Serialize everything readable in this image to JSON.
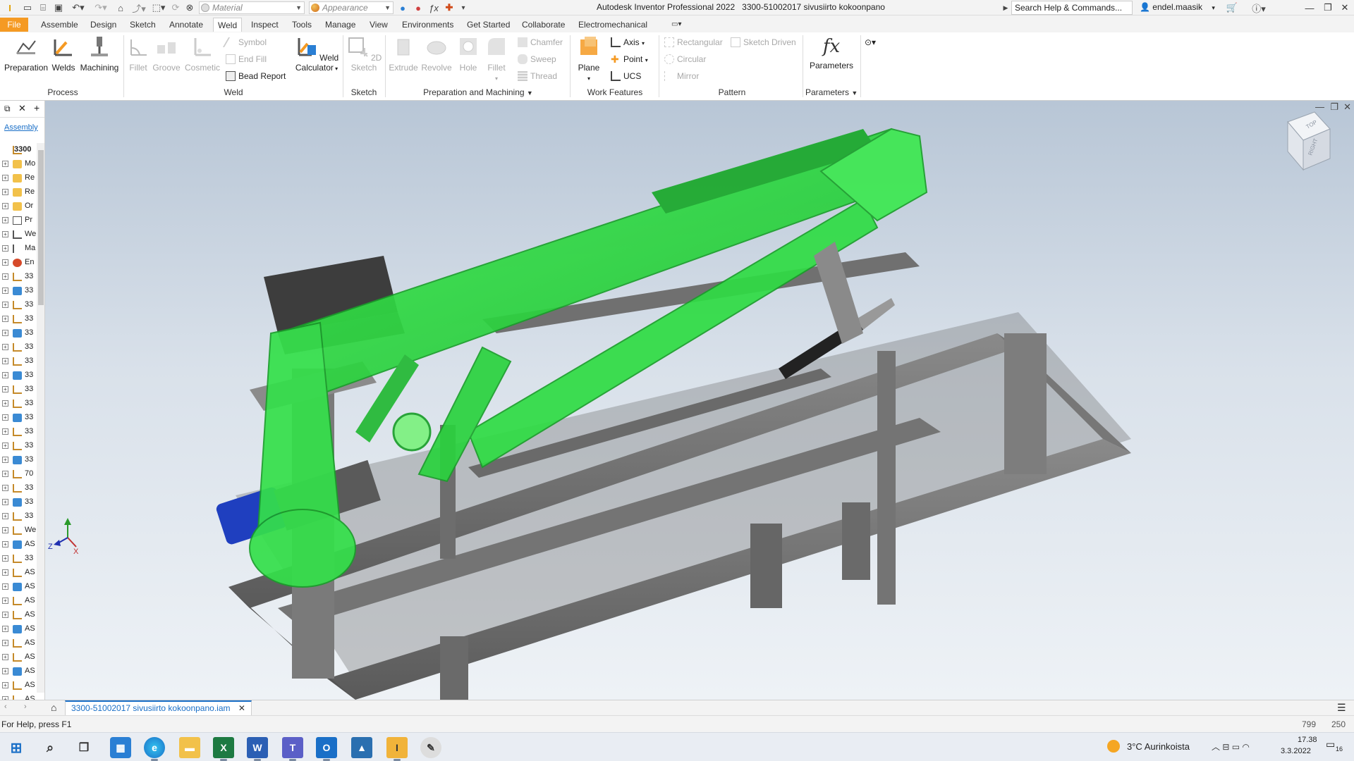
{
  "window": {
    "title": "Autodesk Inventor Professional 2022",
    "document_title": "3300-51002017 sivusiirto kokoonpano"
  },
  "quick_access": {
    "material_combo": "Material",
    "appearance_combo": "Appearance",
    "search_placeholder": "Search Help & Commands...",
    "user": "endel.maasik"
  },
  "tabs": [
    {
      "label": "File"
    },
    {
      "label": "Assemble"
    },
    {
      "label": "Design"
    },
    {
      "label": "Sketch"
    },
    {
      "label": "Annotate"
    },
    {
      "label": "Weld"
    },
    {
      "label": "Inspect"
    },
    {
      "label": "Tools"
    },
    {
      "label": "Manage"
    },
    {
      "label": "View"
    },
    {
      "label": "Environments"
    },
    {
      "label": "Get Started"
    },
    {
      "label": "Collaborate"
    },
    {
      "label": "Electromechanical"
    }
  ],
  "active_tab": "Weld",
  "ribbon": {
    "process": {
      "label": "Process",
      "preparation": "Preparation",
      "welds": "Welds",
      "machining": "Machining"
    },
    "weld": {
      "label": "Weld",
      "fillet": "Fillet",
      "groove": "Groove",
      "cosmetic": "Cosmetic",
      "symbol": "Symbol",
      "end_fill": "End Fill",
      "bead_report": "Bead Report",
      "weld_calc_1": "Weld",
      "weld_calc_2": "Calculator"
    },
    "sketch": {
      "label": "Sketch",
      "sketch2d": "2D Sketch"
    },
    "prep_machining": {
      "label": "Preparation and Machining",
      "extrude": "Extrude",
      "revolve": "Revolve",
      "hole": "Hole",
      "fillet": "Fillet",
      "chamfer": "Chamfer",
      "sweep": "Sweep",
      "thread": "Thread"
    },
    "work_features": {
      "label": "Work Features",
      "plane": "Plane",
      "axis": "Axis",
      "point": "Point",
      "ucs": "UCS"
    },
    "pattern": {
      "label": "Pattern",
      "rectangular": "Rectangular",
      "circular": "Circular",
      "mirror": "Mirror",
      "sketch_driven": "Sketch Driven"
    },
    "parameters": {
      "label": "Parameters",
      "parameters": "Parameters"
    }
  },
  "browser": {
    "tab_label": "Assembly",
    "root_label": "3300",
    "rows": [
      {
        "label": "Mo"
      },
      {
        "label": "Re"
      },
      {
        "label": "Re"
      },
      {
        "label": "Or"
      },
      {
        "label": "Pr"
      },
      {
        "label": "We"
      },
      {
        "label": "Ma"
      },
      {
        "label": "En"
      },
      {
        "label": "33"
      },
      {
        "label": "33"
      },
      {
        "label": "33"
      },
      {
        "label": "33"
      },
      {
        "label": "33"
      },
      {
        "label": "33"
      },
      {
        "label": "33"
      },
      {
        "label": "33"
      },
      {
        "label": "33"
      },
      {
        "label": "33"
      },
      {
        "label": "33"
      },
      {
        "label": "33"
      },
      {
        "label": "33"
      },
      {
        "label": "33"
      },
      {
        "label": "70"
      },
      {
        "label": "33"
      },
      {
        "label": "33"
      },
      {
        "label": "33"
      },
      {
        "label": "We"
      },
      {
        "label": "AS"
      },
      {
        "label": "33"
      },
      {
        "label": "AS"
      },
      {
        "label": "AS"
      },
      {
        "label": "AS"
      },
      {
        "label": "AS"
      },
      {
        "label": "AS"
      },
      {
        "label": "AS"
      },
      {
        "label": "AS"
      },
      {
        "label": "AS"
      },
      {
        "label": "AS"
      },
      {
        "label": "AS"
      }
    ]
  },
  "viewcube": {
    "face_label": "RIGHT",
    "top_label": "TOP"
  },
  "triad": {
    "x": "X",
    "y": "Y",
    "z": "Z"
  },
  "document_tab": "3300-51002017 sivusiirto kokoonpano.iam",
  "status": {
    "help_text": "For Help, press F1",
    "count_a": "799",
    "count_b": "250"
  },
  "taskbar": {
    "weather": "3°C Aurinkoista",
    "time": "17.38",
    "date": "3.3.2022",
    "notifications": "16"
  },
  "colors": {
    "accent": "#1a6fc7",
    "file_tab": "#f59a23",
    "selection_green": "#27d93b",
    "frame_grey": "#6b6b6b"
  }
}
